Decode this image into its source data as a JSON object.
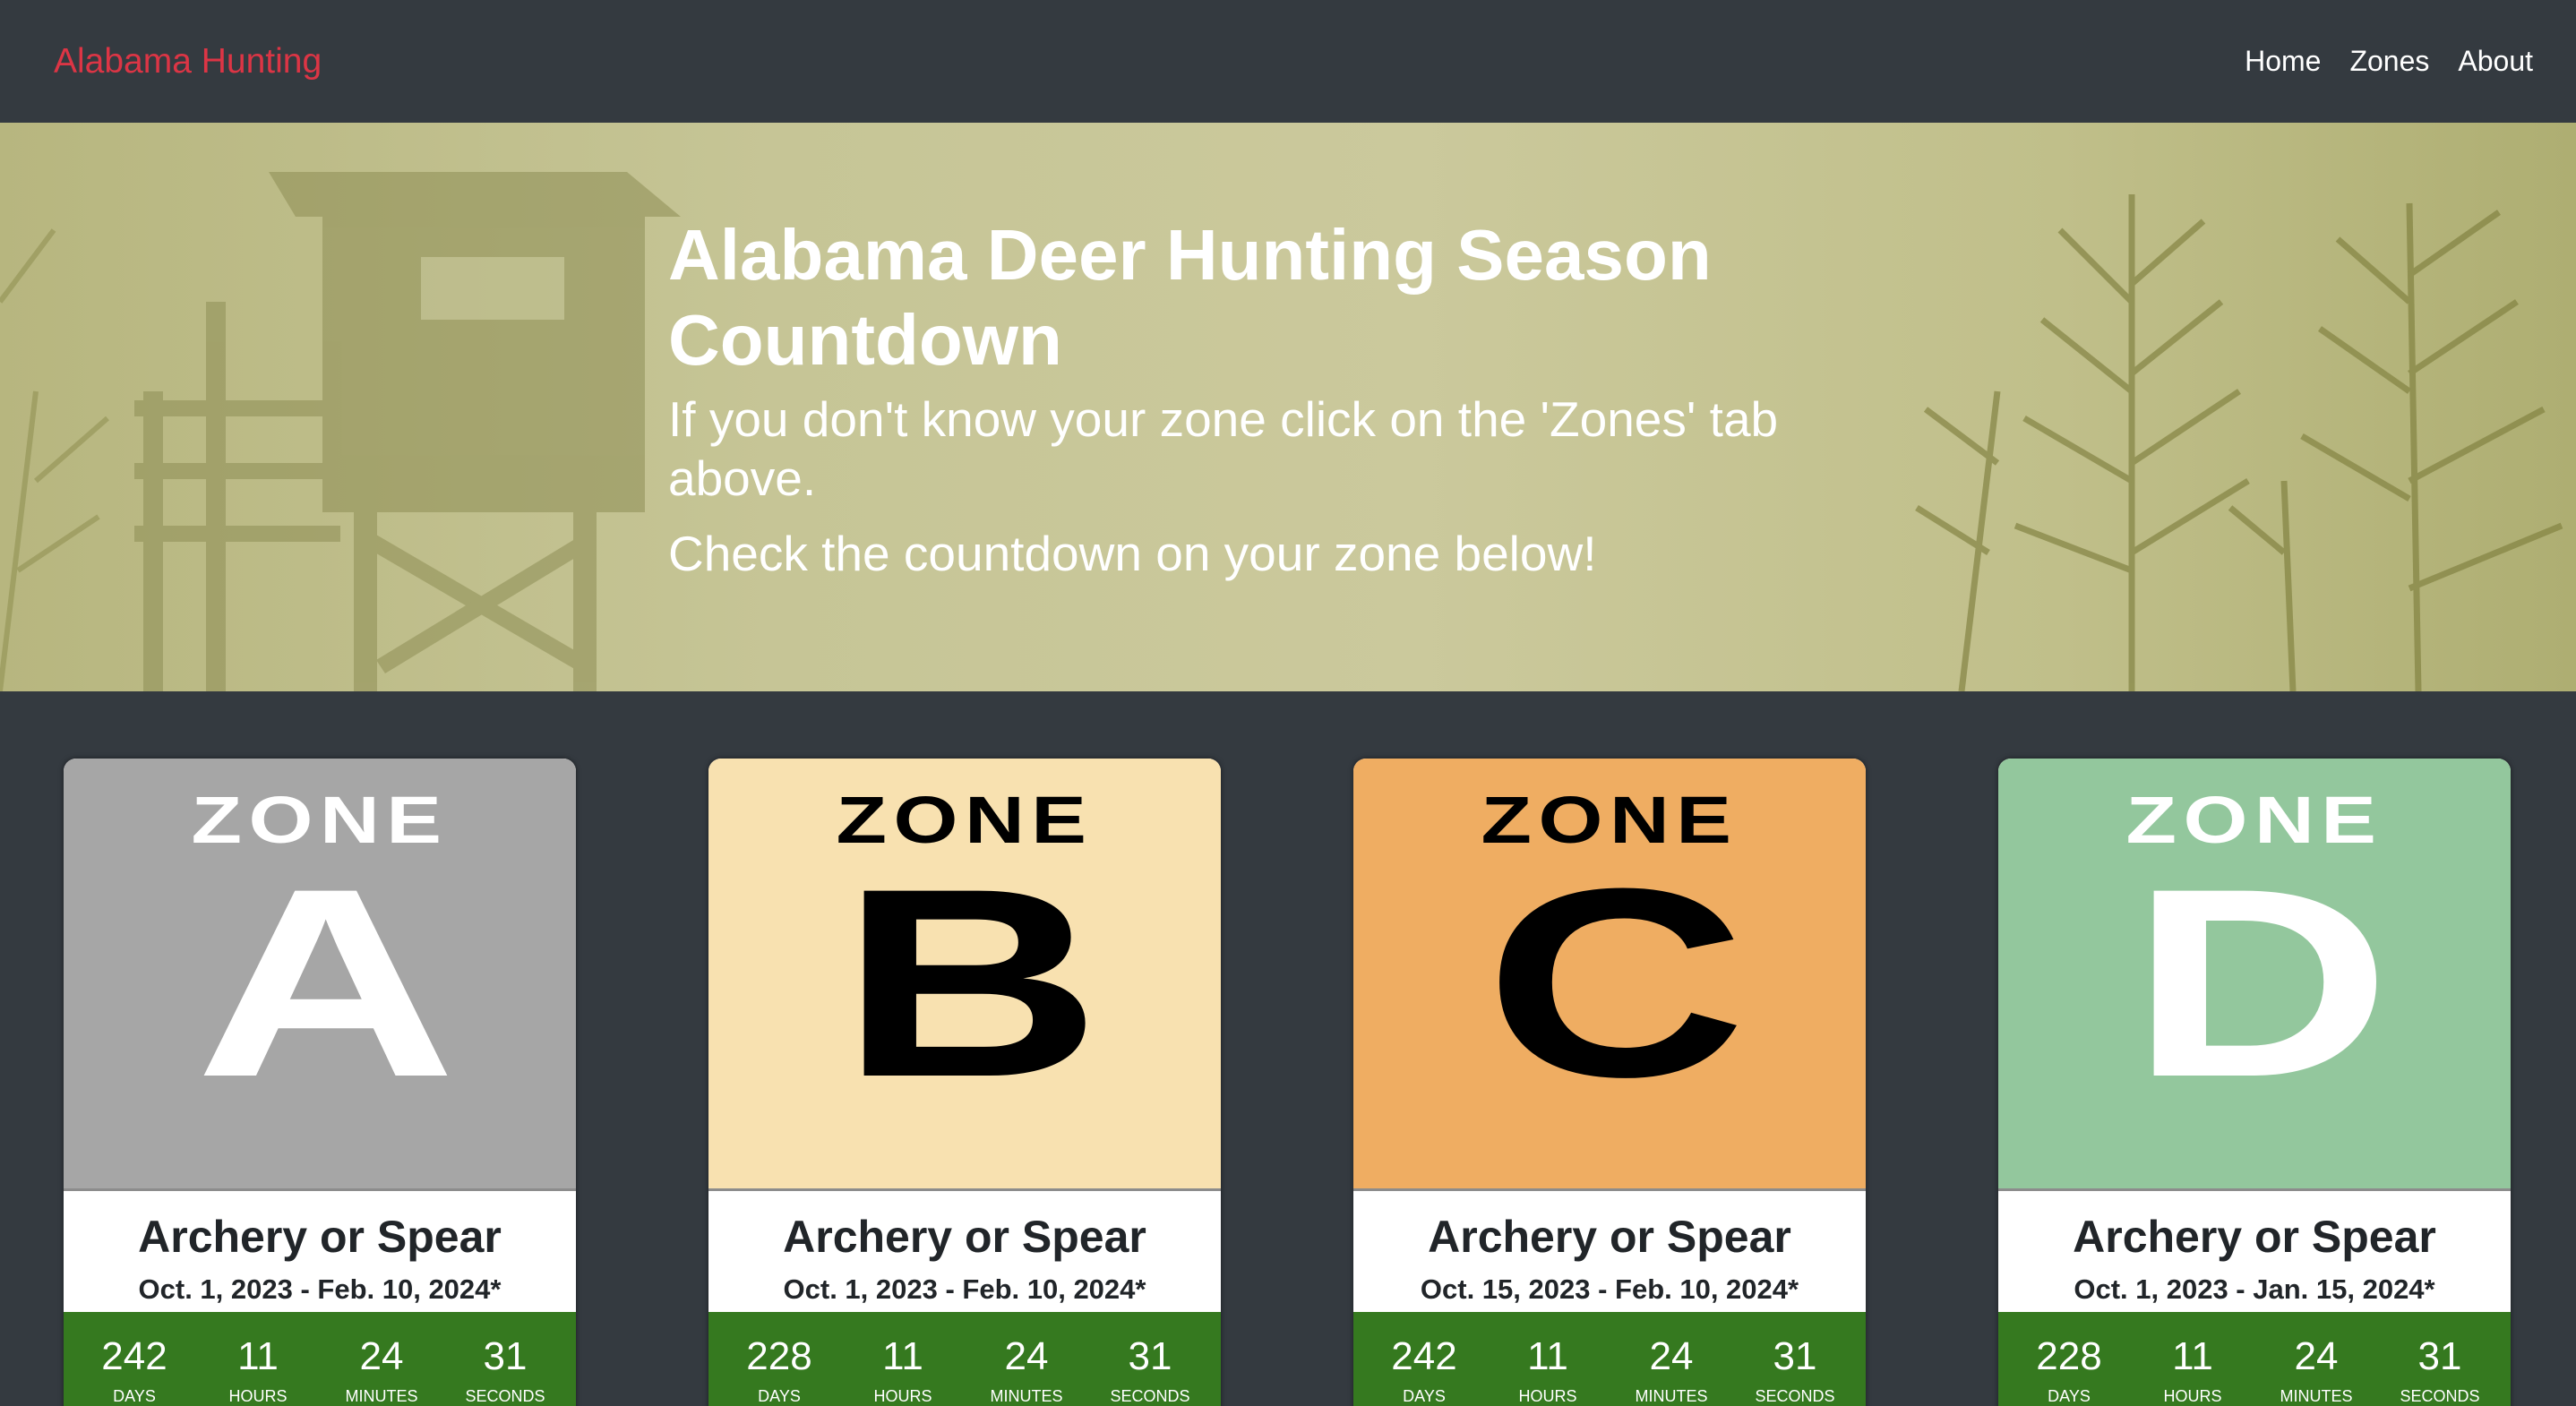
{
  "nav": {
    "brand": "Alabama Hunting",
    "links": [
      "Home",
      "Zones",
      "About"
    ]
  },
  "hero": {
    "title": "Alabama Deer Hunting Season Countdown",
    "line1": "If you don't know your zone click on the 'Zones' tab above.",
    "line2": "Check the countdown on your zone below!"
  },
  "countdown_labels": [
    "DAYS",
    "HOURS",
    "MINUTES",
    "SECONDS"
  ],
  "zones": [
    {
      "word": "ZONE",
      "letter": "A",
      "bg": "#a6a6a6",
      "fg": "#ffffff",
      "season": "Archery or Spear",
      "dates": "Oct. 1, 2023 - Feb. 10, 2024*",
      "countdown": [
        "242",
        "11",
        "24",
        "31"
      ]
    },
    {
      "word": "ZONE",
      "letter": "B",
      "bg": "#f8e1b0",
      "fg": "#000000",
      "season": "Archery or Spear",
      "dates": "Oct. 1, 2023 - Feb. 10, 2024*",
      "countdown": [
        "228",
        "11",
        "24",
        "31"
      ]
    },
    {
      "word": "ZONE",
      "letter": "C",
      "bg": "#efad62",
      "fg": "#000000",
      "season": "Archery or Spear",
      "dates": "Oct. 15, 2023 - Feb. 10, 2024*",
      "countdown": [
        "242",
        "11",
        "24",
        "31"
      ]
    },
    {
      "word": "ZONE",
      "letter": "D",
      "bg": "#93c79d",
      "fg": "#ffffff",
      "season": "Archery or Spear",
      "dates": "Oct. 1, 2023 - Jan. 15, 2024*",
      "countdown": [
        "228",
        "11",
        "24",
        "31"
      ]
    }
  ]
}
